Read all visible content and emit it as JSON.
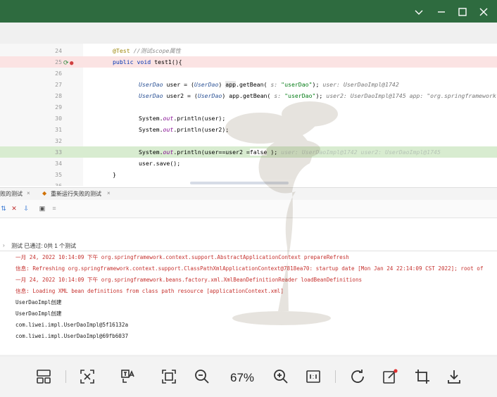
{
  "window": {
    "controls": [
      "chevron-down-icon",
      "minimize-icon",
      "maximize-icon",
      "close-icon"
    ]
  },
  "editor": {
    "lines": [
      {
        "num": "24",
        "text": ""
      },
      {
        "num": "25",
        "text": ""
      },
      {
        "num": "26",
        "text": ""
      },
      {
        "num": "27",
        "text": ""
      },
      {
        "num": "28",
        "text": ""
      },
      {
        "num": "29",
        "text": ""
      },
      {
        "num": "30",
        "text": ""
      },
      {
        "num": "31",
        "text": ""
      },
      {
        "num": "32",
        "text": ""
      },
      {
        "num": "33",
        "text": ""
      },
      {
        "num": "34",
        "text": ""
      },
      {
        "num": "35",
        "text": ""
      },
      {
        "num": "36",
        "text": ""
      }
    ],
    "l24_ann": "@Test",
    "l24_cmt": "//测试scope属性",
    "l25_kw": "public void",
    "l25_rest": "test1(){",
    "l27_type1": "UserDao",
    "l27_a": "user = (",
    "l27_type2": "UserDao",
    "l27_b": ") ",
    "l27_app": "app",
    "l27_c": ".getBean( ",
    "l27_s": "s:",
    "l27_str": "\"userDao\"",
    "l27_d": ");",
    "l27_hint": "user: UserDaoImpl@1742",
    "l28_type1": "UserDao",
    "l28_a": "user2 = (",
    "l28_type2": "UserDao",
    "l28_b": ") app.getBean( ",
    "l28_s": "s:",
    "l28_str": "\"userDao\"",
    "l28_d": ");",
    "l28_hint": "user2: UserDaoImpl@1745    app: \"org.springframework.c",
    "l30_a": "System.",
    "l30_out": "out",
    "l30_b": ".println(user);",
    "l31_a": "System.",
    "l31_out": "out",
    "l31_b": ".println(user2);",
    "l33_a": "System.",
    "l33_out": "out",
    "l33_b": ".println(user==user2 =",
    "l33_val": "false",
    "l33_c": " );",
    "l33_hint": "user: UserDaoImpl@1742    user2: UserDaoImpl@1745",
    "l34": "user.save();",
    "l35": "}"
  },
  "tabs": {
    "tab1": "败的测试",
    "tab2": "重新运行失败的测试"
  },
  "status": {
    "label": "测试 已通过: 0共 1 个测试"
  },
  "console": [
    "一月 24, 2022 10:14:09 下午 org.springframework.context.support.AbstractApplicationContext prepareRefresh",
    "信息: Refreshing org.springframework.context.support.ClassPathXmlApplicationContext@7818ea70: startup date [Mon Jan 24 22:14:09 CST 2022]; root of",
    "一月 24, 2022 10:14:09 下午 org.springframework.beans.factory.xml.XmlBeanDefinitionReader loadBeanDefinitions",
    "信息: Loading XML bean definitions from class path resource [applicationContext.xml]",
    "UserDaoImpl创建",
    "UserDaoImpl创建",
    "com.liwei.impl.UserDaoImpl@5f16132a",
    "com.liwei.impl.UserDaoImpl@69fb6037"
  ],
  "viewer": {
    "zoom": "67%",
    "tools": [
      "layout-icon",
      "fit-icon",
      "translate-icon",
      "crop-select-icon",
      "zoom-out-icon",
      "zoom-in-icon",
      "actual-size-icon",
      "rotate-icon",
      "edit-icon",
      "crop-icon",
      "download-icon"
    ]
  }
}
